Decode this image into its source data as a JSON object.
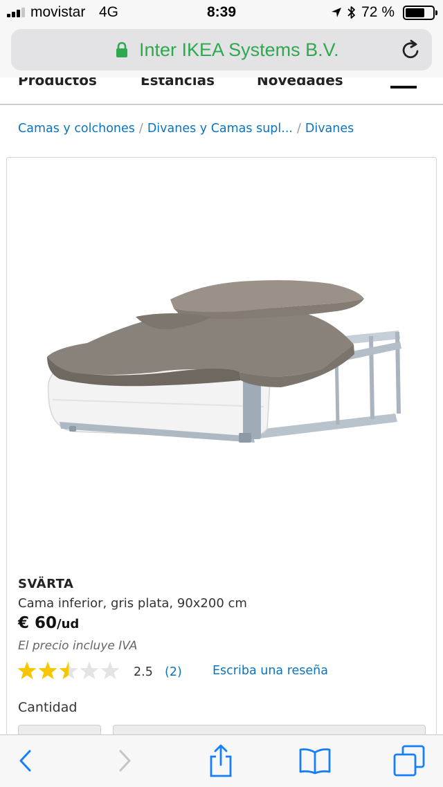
{
  "status_bar": {
    "carrier": "movistar",
    "network": "4G",
    "time": "8:39",
    "battery_percent": "72 %",
    "battery_level": 0.72,
    "icons": [
      "signal-icon",
      "location-arrow-icon",
      "bluetooth-icon",
      "battery-icon"
    ]
  },
  "url_bar": {
    "site_label": "Inter IKEA Systems B.V.",
    "secure": true,
    "icons": [
      "lock-icon",
      "reload-icon"
    ]
  },
  "site_nav": {
    "items": [
      "Productos",
      "Estancias",
      "Novedades"
    ],
    "menu_icon": "hamburger-menu-icon"
  },
  "breadcrumb": {
    "items": [
      "Camas y colchones",
      "Divanes y Camas supl...",
      "Divanes"
    ],
    "separator": "/"
  },
  "product": {
    "name": "SVÄRTA",
    "description": "Cama inferior, gris plata, 90x200 cm",
    "price": "€ 60",
    "price_unit": "/ud",
    "vat_note": "El precio incluye IVA",
    "rating": 2.5,
    "rating_label": "2.5",
    "review_count": "(2)",
    "write_review_label": "Escriba una reseña",
    "quantity_label": "Cantidad",
    "image_icon": "trundle-bed-image"
  },
  "colors": {
    "link": "#0a74c2",
    "secure_green": "#2fa84f",
    "star_filled": "#f7c600",
    "star_empty": "#e4e4e4",
    "ios_blue": "#147efb"
  },
  "toolbar": {
    "icons": [
      "back-icon",
      "forward-icon",
      "share-icon",
      "bookmarks-icon",
      "tabs-icon"
    ]
  }
}
